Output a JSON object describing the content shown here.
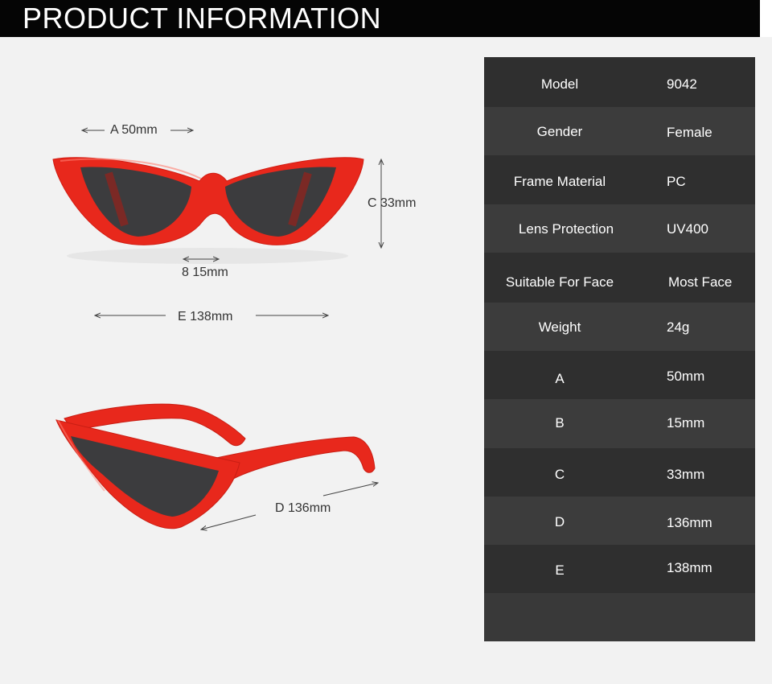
{
  "header": {
    "title": "PRODUCT INFORMATION"
  },
  "specs": [
    {
      "label": "Model",
      "value": "9042"
    },
    {
      "label": "Gender",
      "value": "Female"
    },
    {
      "label": "Frame Material",
      "value": "PC"
    },
    {
      "label": "Lens Protection",
      "value": "UV400"
    },
    {
      "label": "Suitable For Face",
      "value": "Most Face"
    },
    {
      "label": "Weight",
      "value": "24g"
    },
    {
      "label": "A",
      "value": "50mm"
    },
    {
      "label": "B",
      "value": "15mm"
    },
    {
      "label": "C",
      "value": "33mm"
    },
    {
      "label": "D",
      "value": "136mm"
    },
    {
      "label": "E",
      "value": "138mm"
    }
  ],
  "dimensions": {
    "a": "A 50mm",
    "b": "8 15mm",
    "c": "C 33mm",
    "d": "D 136mm",
    "e": "E 138mm"
  },
  "colors": {
    "frame": "#e8281c",
    "lens": "#3c3c3e",
    "header_bg": "#050505",
    "table_bg": "#393939"
  }
}
